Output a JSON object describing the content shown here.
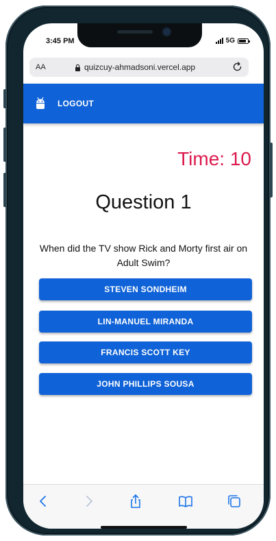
{
  "status_bar": {
    "time": "3:45 PM",
    "network": "5G"
  },
  "browser": {
    "aa_label": "AA",
    "url": "quizcuy-ahmadsoni.vercel.app"
  },
  "app_bar": {
    "logout_label": "LOGOUT",
    "color": "#0f62d7"
  },
  "quiz": {
    "timer_text": "Time: 10",
    "timer_color": "#dc1a4e",
    "question_title": "Question 1",
    "question_text": "When did the TV show Rick and Morty first air on Adult Swim?",
    "answers": [
      "STEVEN SONDHEIM",
      "LIN-MANUEL MIRANDA",
      "FRANCIS SCOTT KEY",
      "JOHN PHILLIPS SOUSA"
    ]
  },
  "toolbar": {
    "icons": [
      "back-icon",
      "forward-icon",
      "share-icon",
      "bookmarks-icon",
      "tabs-icon"
    ]
  }
}
